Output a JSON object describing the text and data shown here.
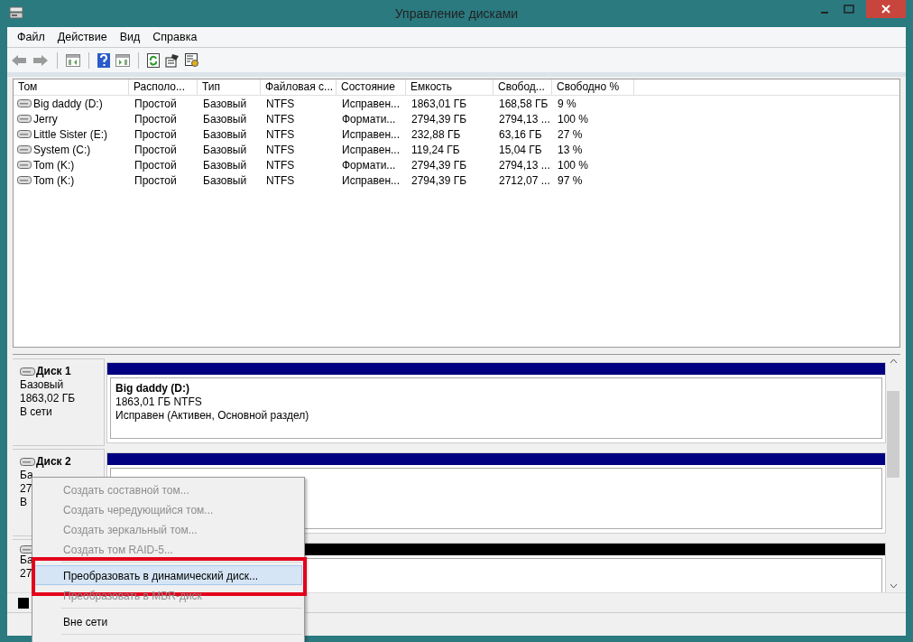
{
  "window": {
    "title": "Управление дисками"
  },
  "menu_bar": [
    "Файл",
    "Действие",
    "Вид",
    "Справка"
  ],
  "toolbar": [
    {
      "kind": "back"
    },
    {
      "kind": "forward"
    },
    {
      "kind": "separator"
    },
    {
      "kind": "tree"
    },
    {
      "kind": "separator"
    },
    {
      "kind": "help"
    },
    {
      "kind": "pane"
    },
    {
      "kind": "separator"
    },
    {
      "kind": "refresh"
    },
    {
      "kind": "properties"
    },
    {
      "kind": "settings"
    }
  ],
  "volumes": {
    "columns": [
      "Том",
      "Располо...",
      "Тип",
      "Файловая с...",
      "Состояние",
      "Емкость",
      "Свобод...",
      "Свободно %"
    ],
    "rows": [
      [
        "Big daddy (D:)",
        "Простой",
        "Базовый",
        "NTFS",
        "Исправен...",
        "1863,01 ГБ",
        "168,58 ГБ",
        "9 %"
      ],
      [
        "Jerry",
        "Простой",
        "Базовый",
        "NTFS",
        "Формати...",
        "2794,39 ГБ",
        "2794,13 ...",
        "100 %"
      ],
      [
        "Little Sister (E:)",
        "Простой",
        "Базовый",
        "NTFS",
        "Исправен...",
        "232,88 ГБ",
        "63,16 ГБ",
        "27 %"
      ],
      [
        "System (C:)",
        "Простой",
        "Базовый",
        "NTFS",
        "Исправен...",
        "119,24 ГБ",
        "15,04 ГБ",
        "13 %"
      ],
      [
        "Tom (K:)",
        "Простой",
        "Базовый",
        "NTFS",
        "Формати...",
        "2794,39 ГБ",
        "2794,13 ...",
        "100 %"
      ],
      [
        "Tom (K:)",
        "Простой",
        "Базовый",
        "NTFS",
        "Исправен...",
        "2794,39 ГБ",
        "2712,07 ...",
        "97 %"
      ]
    ]
  },
  "disks": [
    {
      "name": "Диск 1",
      "lines": [
        "Базовый",
        "1863,02 ГБ",
        "В сети"
      ],
      "partitions": [
        {
          "kind": "primary",
          "title": "Big daddy  (D:)",
          "lines": [
            "1863,01 ГБ NTFS",
            "Исправен (Активен, Основной раздел)"
          ]
        }
      ]
    },
    {
      "name": "Диск 2",
      "lines": [
        "Ба",
        "27",
        "В"
      ],
      "partitions": [
        {
          "kind": "primary"
        }
      ]
    },
    {
      "lines": [
        "Ба",
        "27"
      ],
      "partitions": [
        {
          "kind": "unallocated"
        }
      ]
    }
  ],
  "legend": [
    {
      "color": "#000000"
    }
  ],
  "context_menu": {
    "items": [
      {
        "kind": "item",
        "label": "Создать составной том...",
        "disabled": true,
        "selected": false
      },
      {
        "kind": "item",
        "label": "Создать чередующийся том...",
        "disabled": true,
        "selected": false
      },
      {
        "kind": "item",
        "label": "Создать зеркальный том...",
        "disabled": true,
        "selected": false
      },
      {
        "kind": "item",
        "label": "Создать том RAID-5...",
        "disabled": true,
        "selected": false
      },
      {
        "kind": "separator"
      },
      {
        "kind": "item",
        "label": "Преобразовать в динамический диск...",
        "disabled": false,
        "selected": true,
        "annotated": true
      },
      {
        "kind": "item",
        "label": "Преобразовать в MBR-диск",
        "disabled": true,
        "selected": false
      },
      {
        "kind": "separator"
      },
      {
        "kind": "item",
        "label": "Вне сети",
        "disabled": false,
        "selected": false
      },
      {
        "kind": "separator"
      }
    ]
  }
}
